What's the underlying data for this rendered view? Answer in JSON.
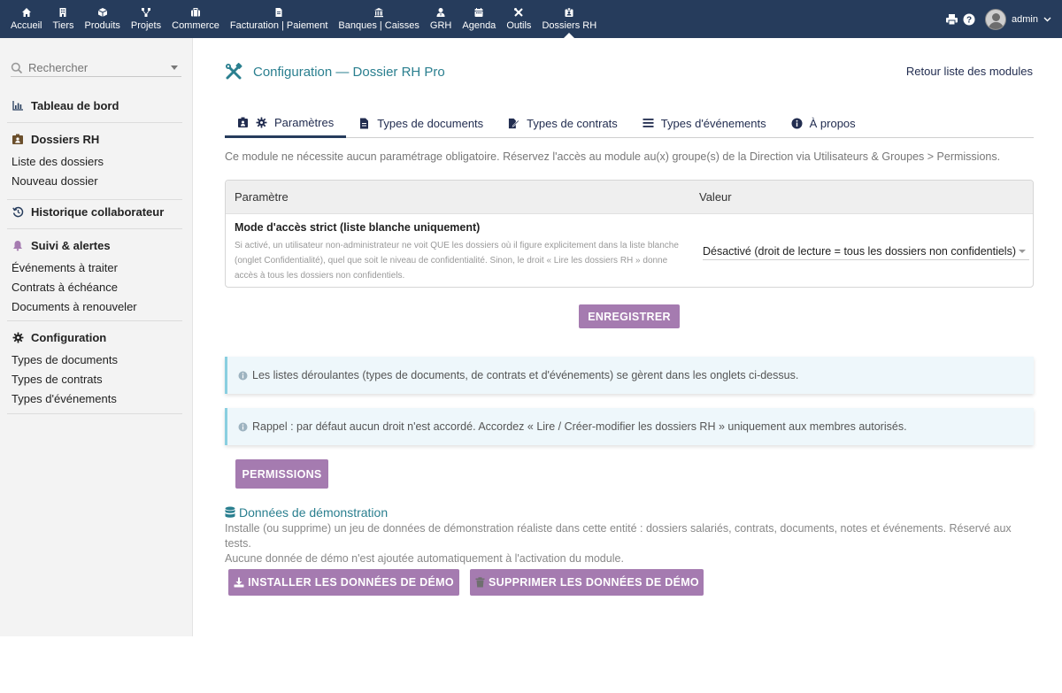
{
  "topnav": {
    "items": [
      {
        "label": "Accueil",
        "icon": "home-icon"
      },
      {
        "label": "Tiers",
        "icon": "building-icon"
      },
      {
        "label": "Produits",
        "icon": "cube-icon"
      },
      {
        "label": "Projets",
        "icon": "sitemap-icon"
      },
      {
        "label": "Commerce",
        "icon": "suitcase-icon"
      },
      {
        "label": "Facturation | Paiement",
        "icon": "invoice-icon"
      },
      {
        "label": "Banques | Caisses",
        "icon": "bank-icon"
      },
      {
        "label": "GRH",
        "icon": "user-tie-icon"
      },
      {
        "label": "Agenda",
        "icon": "calendar-icon"
      },
      {
        "label": "Outils",
        "icon": "tools-icon"
      },
      {
        "label": "Dossiers RH",
        "icon": "id-badge-icon"
      }
    ],
    "active": "Dossiers RH",
    "user": "admin"
  },
  "sidebar": {
    "search_placeholder": "Rechercher",
    "dashboard": "Tableau de bord",
    "dossiers": {
      "title": "Dossiers RH",
      "links": [
        "Liste des dossiers",
        "Nouveau dossier"
      ]
    },
    "historique": "Historique collaborateur",
    "suivi": {
      "title": "Suivi & alertes",
      "links": [
        "Événements à traiter",
        "Contrats à échéance",
        "Documents à renouveler"
      ]
    },
    "config": {
      "title": "Configuration",
      "links": [
        "Types de documents",
        "Types de contrats",
        "Types d'événements"
      ]
    }
  },
  "page": {
    "title": "Configuration — Dossier RH Pro",
    "back_link": "Retour liste des modules",
    "tabs": [
      {
        "label": "Paramètres",
        "icon": "gear-icon"
      },
      {
        "label": "Types de documents",
        "icon": "file-icon"
      },
      {
        "label": "Types de contrats",
        "icon": "signature-icon"
      },
      {
        "label": "Types d'événements",
        "icon": "list-icon"
      },
      {
        "label": "À propos",
        "icon": "info-icon"
      }
    ],
    "intro": "Ce module ne nécessite aucun paramétrage obligatoire. Réservez l'accès au module au(x) groupe(s) de la Direction via Utilisateurs & Groupes > Permissions.",
    "table": {
      "col_param": "Paramètre",
      "col_value": "Valeur",
      "row": {
        "name": "Mode d'accès strict (liste blanche uniquement)",
        "desc": "Si activé, un utilisateur non-administrateur ne voit QUE les dossiers où il figure explicitement dans la liste blanche (onglet Confidentialité), quel que soit le niveau de confidentialité. Sinon, le droit « Lire les dossiers RH » donne accès à tous les dossiers non confidentiels.",
        "value": "Désactivé (droit de lecture = tous les dossiers non confidentiels)"
      }
    },
    "save_button": "ENREGISTRER",
    "info1": "Les listes déroulantes (types de documents, de contrats et d'événements) se gèrent dans les onglets ci-dessus.",
    "info2": "Rappel : par défaut aucun droit n'est accordé. Accordez « Lire / Créer-modifier les dossiers RH » uniquement aux membres autorisés.",
    "permissions_button": "PERMISSIONS",
    "demo": {
      "title": "Données de démonstration",
      "desc1": "Installe (ou supprime) un jeu de données de démonstration réaliste dans cette entité : dossiers salariés, contrats, documents, notes et événements. Réservé aux tests.",
      "desc2": "Aucune donnée de démo n'est ajoutée automatiquement à l'activation du module.",
      "install_button": "INSTALLER LES DONNÉES DE DÉMO",
      "delete_button": "SUPPRIMER LES DONNÉES DE DÉMO"
    }
  },
  "colors": {
    "topbar": "#263c5c",
    "accent_teal": "#2a7f8f",
    "button_purple": "#a57bb0",
    "info_border": "#89cfe0"
  }
}
